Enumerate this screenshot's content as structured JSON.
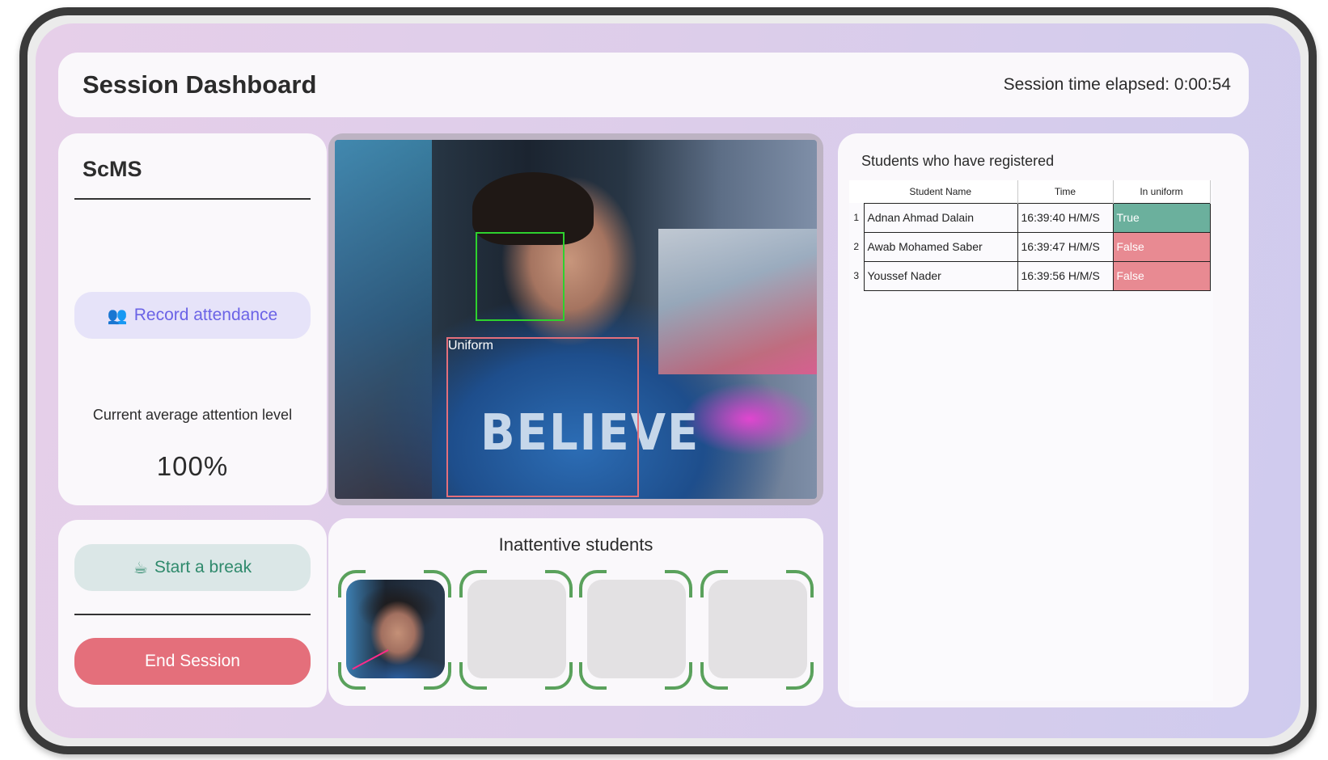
{
  "header": {
    "title": "Session Dashboard",
    "elapsed": "Session time elapsed: 0:00:54"
  },
  "sidebar": {
    "brand": "ScMS",
    "record_button": {
      "icon": "people-icon",
      "label": "Record attendance"
    },
    "attention_label": "Current average attention level",
    "attention_value": "100%",
    "break_button": {
      "icon": "teapot-icon",
      "label": "Start a break"
    },
    "end_button": "End Session"
  },
  "video": {
    "uniform_label": "Uniform",
    "hoodie_text": "BELIEVE",
    "face_box_color": "#2ed12e",
    "uniform_box_color": "#e46f7b"
  },
  "inattentive": {
    "title": "Inattentive students",
    "slots": [
      "occupied",
      "empty",
      "empty",
      "empty"
    ]
  },
  "registered": {
    "title": "Students who have registered",
    "columns": [
      "Student Name",
      "Time",
      "In uniform"
    ],
    "rows": [
      {
        "index": "1",
        "name": "Adnan Ahmad Dalain",
        "time": "16:39:40 H/M/S",
        "uniform": "True"
      },
      {
        "index": "2",
        "name": "Awab Mohamed Saber",
        "time": "16:39:47 H/M/S",
        "uniform": "False"
      },
      {
        "index": "3",
        "name": "Youssef Nader",
        "time": "16:39:56 H/M/S",
        "uniform": "False"
      }
    ]
  },
  "colors": {
    "true_cell": "#6bb09d",
    "false_cell": "#e88a92",
    "end_button": "#e46f7b",
    "record_text": "#6b63e6",
    "break_text": "#2f8a6c"
  }
}
